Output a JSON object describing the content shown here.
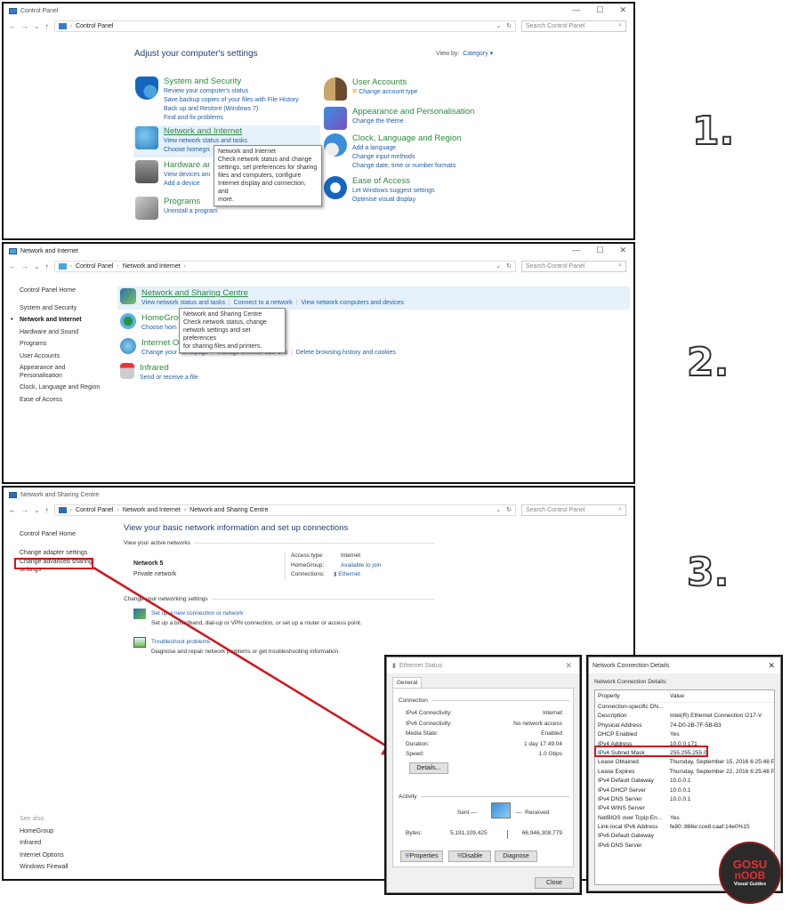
{
  "step_labels": [
    "1.",
    "2.",
    "3."
  ],
  "window1": {
    "title": "Control Panel",
    "breadcrumb": [
      "Control Panel"
    ],
    "search_placeholder": "Search Control Panel",
    "heading": "Adjust your computer's settings",
    "view_by_label": "View by:",
    "view_by_value": "Category",
    "categories": [
      {
        "title": "System and Security",
        "links": [
          "Review your computer's status",
          "Save backup copies of your files with File History",
          "Back up and Restore (Windows 7)",
          "Find and fix problems"
        ]
      },
      {
        "title": "Network and Internet",
        "links": [
          "View network status and tasks",
          "Choose homegroup and sharing options"
        ]
      },
      {
        "title": "Hardware and Sound",
        "links": [
          "View devices and printers",
          "Add a device"
        ]
      },
      {
        "title": "Programs",
        "links": [
          "Uninstall a program"
        ]
      },
      {
        "title": "User Accounts",
        "links": [
          "Change account type"
        ]
      },
      {
        "title": "Appearance and Personalisation",
        "links": [
          "Change the theme"
        ]
      },
      {
        "title": "Clock, Language and Region",
        "links": [
          "Add a language",
          "Change input methods",
          "Change date, time or number formats"
        ]
      },
      {
        "title": "Ease of Access",
        "links": [
          "Let Windows suggest settings",
          "Optimise visual display"
        ]
      }
    ],
    "tooltip": [
      "Network and Internet",
      "Check network status and change",
      "settings, set preferences for sharing",
      "files and computers, configure",
      "Internet display and connection, and",
      "more."
    ]
  },
  "window2": {
    "title": "Network and Internet",
    "breadcrumb": [
      "Control Panel",
      "Network and Internet"
    ],
    "search_placeholder": "Search Control Panel",
    "sidebar": [
      "Control Panel Home",
      "System and Security",
      "Network and Internet",
      "Hardware and Sound",
      "Programs",
      "User Accounts",
      "Appearance and Personalisation",
      "Clock, Language and Region",
      "Ease of Access"
    ],
    "sections": [
      {
        "title": "Network and Sharing Centre",
        "links": [
          "View network status and tasks",
          "Connect to a network",
          "View network computers and devices"
        ]
      },
      {
        "title": "HomeGroup",
        "links": [
          "Choose homegroup and sharing options"
        ]
      },
      {
        "title": "Internet Options",
        "links": [
          "Change your homepage",
          "Manage browser add-ons",
          "Delete browsing history and cookies"
        ]
      },
      {
        "title": "Infrared",
        "links": [
          "Send or receive a file"
        ]
      }
    ],
    "tooltip": [
      "Network and Sharing Centre",
      "Check network status, change",
      "network settings and set preferences",
      "for sharing files and printers."
    ]
  },
  "window3": {
    "title": "Network and Sharing Centre",
    "breadcrumb": [
      "Control Panel",
      "Network and Internet",
      "Network and Sharing Centre"
    ],
    "search_placeholder": "Search Control Panel",
    "sidebar": [
      "Control Panel Home",
      "Change adapter settings",
      "Change advanced sharing settings"
    ],
    "see_also_label": "See also",
    "see_also": [
      "HomeGroup",
      "Infrared",
      "Internet Options",
      "Windows Firewall"
    ],
    "heading": "View your basic network information and set up connections",
    "active_networks_label": "View your active networks",
    "network_name": "Network 5",
    "network_type": "Private network",
    "access_type_label": "Access type:",
    "access_type": "Internet",
    "homegroup_label": "HomeGroup:",
    "homegroup": "Available to join",
    "connections_label": "Connections:",
    "connections": "Ethernet",
    "change_settings_label": "Change your networking settings",
    "tasks": [
      {
        "title": "Set up a new connection or network",
        "desc": "Set up a broadband, dial-up or VPN connection, or set up a router or access point."
      },
      {
        "title": "Troubleshoot problems",
        "desc": "Diagnose and repair network problems or get troubleshooting information."
      }
    ]
  },
  "ethernet_status": {
    "title": "Ethernet Status",
    "tab": "General",
    "connection_label": "Connection",
    "rows": [
      {
        "k": "IPv4 Connectivity:",
        "v": "Internet"
      },
      {
        "k": "IPv6 Connectivity:",
        "v": "No network access"
      },
      {
        "k": "Media State:",
        "v": "Enabled"
      },
      {
        "k": "Duration:",
        "v": "1 day 17:49:04"
      },
      {
        "k": "Speed:",
        "v": "1.0 Gbps"
      }
    ],
    "details_btn": "Details...",
    "activity_label": "Activity",
    "sent_label": "Sent",
    "received_label": "Received",
    "bytes_label": "Bytes:",
    "bytes_sent": "5,191,109,425",
    "bytes_received": "66,946,308,779",
    "properties_btn": "Properties",
    "disable_btn": "Disable",
    "diagnose_btn": "Diagnose",
    "close_btn": "Close"
  },
  "net_details": {
    "title": "Network Connection Details",
    "subtitle": "Network Connection Details:",
    "col_property": "Property",
    "col_value": "Value",
    "rows": [
      {
        "p": "Connection-specific DN...",
        "v": ""
      },
      {
        "p": "Description",
        "v": "Intel(R) Ethernet Connection I217-V"
      },
      {
        "p": "Physical Address",
        "v": "74-D0-2B-7F-5B-B3"
      },
      {
        "p": "DHCP Enabled",
        "v": "Yes"
      },
      {
        "p": "IPv4 Address",
        "v": "10.0.0.171"
      },
      {
        "p": "IPv4 Subnet Mask",
        "v": "255.255.255.0"
      },
      {
        "p": "Lease Obtained",
        "v": "Thursday, September 15, 2016 6:25:48 P"
      },
      {
        "p": "Lease Expires",
        "v": "Thursday, September 22, 2016 6:25:48 P"
      },
      {
        "p": "IPv4 Default Gateway",
        "v": "10.0.0.1"
      },
      {
        "p": "IPv4 DHCP Server",
        "v": "10.0.0.1"
      },
      {
        "p": "IPv4 DNS Server",
        "v": "10.0.0.1"
      },
      {
        "p": "IPv4 WINS Server",
        "v": ""
      },
      {
        "p": "NetBIOS over Tcpip En...",
        "v": "Yes"
      },
      {
        "p": "Link-local IPv6 Address",
        "v": "fe80::886e:cce8:caaf:14e0%15"
      },
      {
        "p": "IPv6 Default Gateway",
        "v": ""
      },
      {
        "p": "IPv6 DNS Server",
        "v": ""
      }
    ]
  },
  "watermark": {
    "line1": "GOSU",
    "line2": "nOOB",
    "line3": "Visual Guides"
  },
  "colors": {
    "highlight": "#d0141c",
    "link": "#1f5fa6",
    "category_green": "#2b8a3e"
  }
}
